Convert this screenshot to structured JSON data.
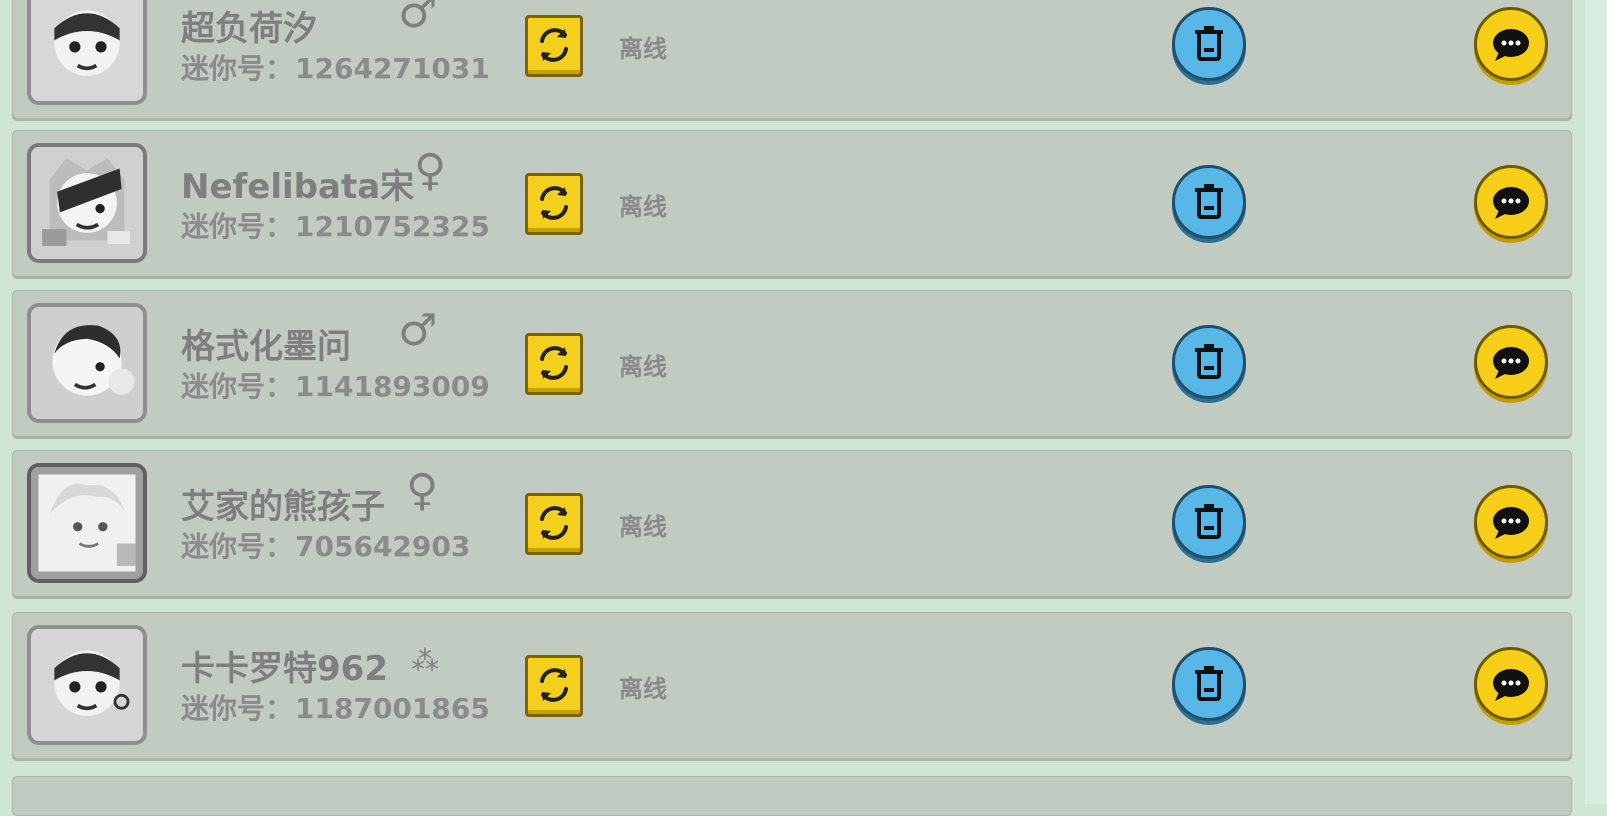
{
  "friends": [
    {
      "name": "超负荷汐",
      "gender_icon": "male-icon",
      "gender_symbol": "♂",
      "mini_label": "迷你号：",
      "mini_id": "1264271031",
      "status": "离线"
    },
    {
      "name": "Nefelibata宋",
      "gender_icon": "female-icon",
      "gender_symbol": "♀",
      "mini_label": "迷你号：",
      "mini_id": "1210752325",
      "status": "离线"
    },
    {
      "name": "格式化墨问",
      "gender_icon": "male-icon",
      "gender_symbol": "♂",
      "mini_label": "迷你号：",
      "mini_id": "1141893009",
      "status": "离线"
    },
    {
      "name": "艾家的熊孩子",
      "gender_icon": "female-icon",
      "gender_symbol": "♀",
      "mini_label": "迷你号：",
      "mini_id": "705642903",
      "status": "离线"
    },
    {
      "name": "卡卡罗特962",
      "gender_icon": "mask-icon",
      "gender_symbol": "⁂",
      "mini_label": "迷你号：",
      "mini_id": "1187001865",
      "status": "离线"
    }
  ],
  "colors": {
    "row_background": "#c1cbc1",
    "delete_button": "#57b8e8",
    "chat_button": "#f6ce18",
    "swap_button": "#f5cf1d"
  }
}
